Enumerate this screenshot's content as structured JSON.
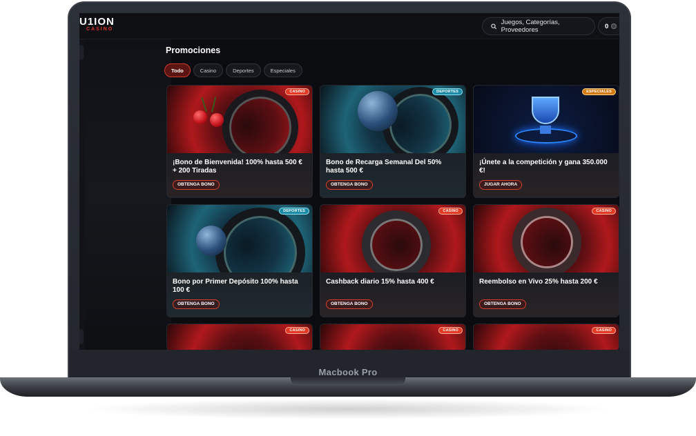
{
  "device": {
    "label": "Macbook Pro"
  },
  "header": {
    "logo_main": "U1ION",
    "logo_sub": "CASINO",
    "search_placeholder": "Juegos, Categorías, Proveedores",
    "balance": "0"
  },
  "page": {
    "title": "Promociones",
    "filters": [
      {
        "label": "Todo",
        "active": true
      },
      {
        "label": "Casino",
        "active": false
      },
      {
        "label": "Deportes",
        "active": false
      },
      {
        "label": "Especiales",
        "active": false
      }
    ]
  },
  "promotions": [
    {
      "badge": "CASINO",
      "title": "¡Bono de Bienvenida! 100% hasta 500 € + 200 Tiradas",
      "cta": "OBTENGA BONO"
    },
    {
      "badge": "DEPORTES",
      "title": "Bono de Recarga Semanal Del 50% hasta 500 €",
      "cta": "OBTENGA BONO"
    },
    {
      "badge": "ESPECIALES",
      "title": "¡Únete a la competición y gana 350.000 €!",
      "cta": "JUGAR AHORA"
    },
    {
      "badge": "DEPORTES",
      "title": "Bono por Primer Depósito 100% hasta 100 €",
      "cta": "OBTENGA BONO"
    },
    {
      "badge": "CASINO",
      "title": "Cashback diario 15% hasta 400 €",
      "cta": "OBTENGA BONO"
    },
    {
      "badge": "CASINO",
      "title": "Reembolso en Vivo 25% hasta 200 €",
      "cta": "OBTENGA BONO"
    },
    {
      "badge": "CASINO"
    },
    {
      "badge": "CASINO"
    },
    {
      "badge": "CASINO"
    }
  ],
  "icons": {
    "search": "search-icon",
    "coin": "coin-icon"
  },
  "colors": {
    "accent_red": "#d23a2a",
    "badge_casino": "#e23a24",
    "badge_deportes": "#1d8aa6",
    "badge_especiales": "#d47a12"
  }
}
